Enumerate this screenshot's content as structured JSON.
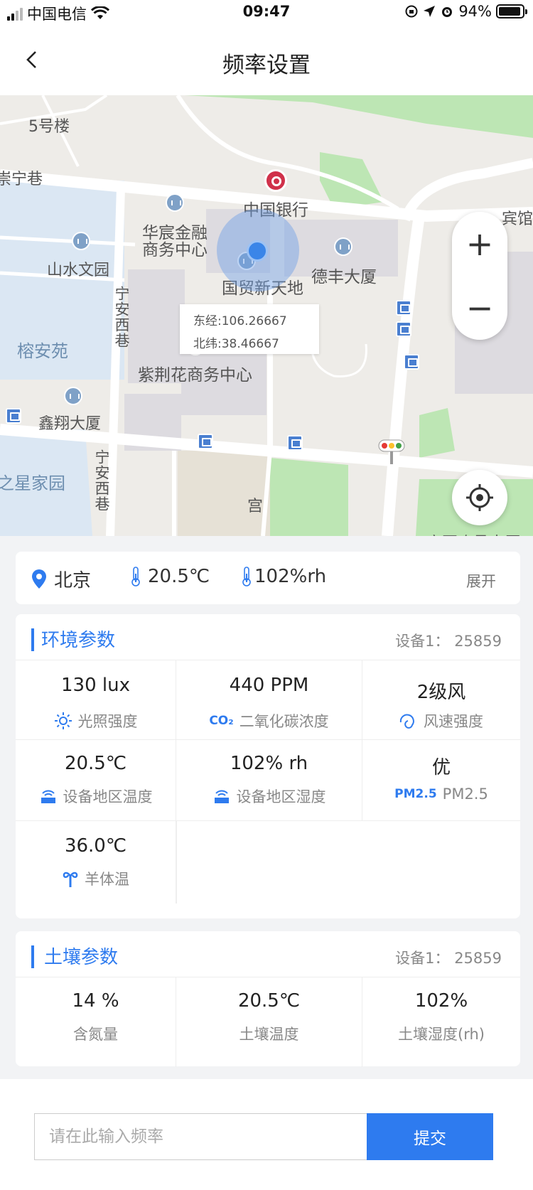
{
  "status": {
    "carrier": "中国电信",
    "time": "09:47",
    "battery": "94%",
    "battery_level": 0.94,
    "signal_bars": 2
  },
  "nav": {
    "title": "频率设置",
    "back_icon": "chevron-left-icon"
  },
  "map": {
    "labels": {
      "l1": "5号楼",
      "l2": "崇宁巷",
      "l3": "中国银行",
      "l4": "华宸金融",
      "l5": "商务中心",
      "l6": "山水文园",
      "l7": "德丰大厦",
      "l8": "国贸新天地",
      "l9": "宁安西巷",
      "l10": "榕安苑",
      "l11": "紫荆花商务中心",
      "l12": "鑫翔大厦",
      "l13": "宁安西巷",
      "l14": "之星家园",
      "l15": "宾馆",
      "l16": "宫",
      "l17": "宁夏农垦大厦"
    },
    "popup": {
      "lng": "东经:106.26667",
      "lat": "北纬:38.46667"
    },
    "zoom_in": "+",
    "zoom_out": "−"
  },
  "weather": {
    "city": "北京",
    "temperature": "20.5℃",
    "humidity": "102%rh",
    "expand": "展开"
  },
  "env": {
    "title": "环境参数",
    "device": "设备1：  25859",
    "cells": [
      {
        "value": "130 lux",
        "label": "光照强度",
        "icon": "sun-icon"
      },
      {
        "value": "440 PPM",
        "label": "二氧化碳浓度",
        "icon_text": "CO₂"
      },
      {
        "value": "2级风",
        "label": "风速强度",
        "icon": "wind-icon"
      },
      {
        "value": "20.5℃",
        "label": "设备地区温度",
        "icon": "device-signal-icon"
      },
      {
        "value": "102% rh",
        "label": "设备地区湿度",
        "icon": "device-signal-icon"
      },
      {
        "value": "优",
        "label": "PM2.5",
        "icon_text": "PM2.5"
      },
      {
        "value": "36.0℃",
        "label": "羊体温",
        "icon": "sheep-icon"
      }
    ]
  },
  "soil": {
    "title": "土壤参数",
    "device": "设备1：  25859",
    "cells": [
      {
        "value": "14 %",
        "label": "含氮量"
      },
      {
        "value": "20.5℃",
        "label": "土壤温度"
      },
      {
        "value": "102%",
        "label": "土壤湿度(rh)"
      }
    ]
  },
  "form": {
    "placeholder": "请在此输入频率",
    "submit": "提交"
  },
  "colors": {
    "accent": "#2e7bef",
    "bank": "#d0314a",
    "park": "#bde6b4",
    "water": "#dbe7f3"
  }
}
